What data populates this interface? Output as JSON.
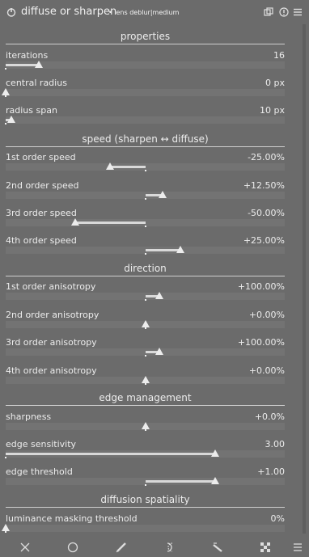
{
  "header": {
    "title": "diffuse or sharpen",
    "label": "• lens deblur|medium"
  },
  "sections": {
    "properties": "properties",
    "speed": "speed (sharpen ↔ diffuse)",
    "direction": "direction",
    "edge": "edge management",
    "spatiality": "diffusion spatiality"
  },
  "sliders": [
    {
      "label": "iterations",
      "value": "16",
      "fraction": 0.12
    },
    {
      "label": "central radius",
      "value": "0 px",
      "fraction": 0.0
    },
    {
      "label": "radius span",
      "value": "10 px",
      "fraction": 0.02
    },
    {
      "label": "1st order speed",
      "value": "-25.00%",
      "fraction": -0.25
    },
    {
      "label": "2nd order speed",
      "value": "+12.50%",
      "fraction": 0.125
    },
    {
      "label": "3rd order speed",
      "value": "-50.00%",
      "fraction": -0.5
    },
    {
      "label": "4th order speed",
      "value": "+25.00%",
      "fraction": 0.25
    },
    {
      "label": "1st order anisotropy",
      "value": "+100.00%",
      "fraction": 0.1
    },
    {
      "label": "2nd order anisotropy",
      "value": "+0.00%",
      "fraction": 0.0
    },
    {
      "label": "3rd order anisotropy",
      "value": "+100.00%",
      "fraction": 0.1
    },
    {
      "label": "4th order anisotropy",
      "value": "+0.00%",
      "fraction": 0.0
    },
    {
      "label": "sharpness",
      "value": "+0.0%",
      "fraction": 0.0
    },
    {
      "label": "edge sensitivity",
      "value": "3.00",
      "fraction": 0.75
    },
    {
      "label": "edge threshold",
      "value": "+1.00",
      "fraction": 0.5
    },
    {
      "label": "luminance masking threshold",
      "value": "0%",
      "fraction": 0.0
    }
  ],
  "toolbar": {
    "icons": [
      "close-icon",
      "circle-mask-icon",
      "drawn-mask-icon",
      "parametric-mask-icon",
      "drawn-parametric-mask-icon",
      "raster-mask-icon",
      "menu-icon"
    ]
  },
  "colors": {
    "background": "#6b6b6b",
    "track": "#737373",
    "fill": "#d9d9d9",
    "text": "#ececec"
  }
}
